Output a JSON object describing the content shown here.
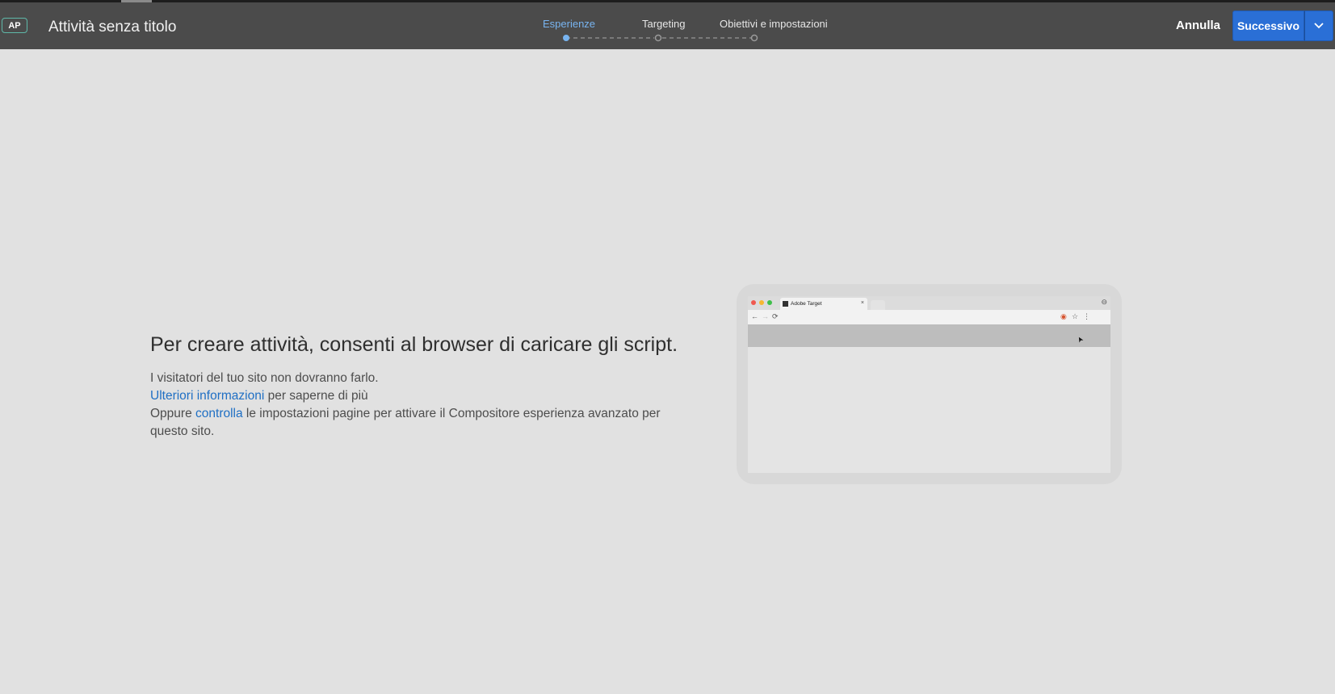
{
  "header": {
    "badge": "AP",
    "title": "Attività senza titolo",
    "steps": [
      {
        "label": "Esperienze",
        "active": true
      },
      {
        "label": "Targeting",
        "active": false
      },
      {
        "label": "Obiettivi e impostazioni",
        "active": false
      }
    ],
    "cancel_label": "Annulla",
    "next_label": "Successivo"
  },
  "main": {
    "heading": "Per creare attività, consenti al browser di caricare gli script.",
    "line1": "I visitatori del tuo sito non dovranno farlo.",
    "line2_link": "Ulteriori informazioni",
    "line2_rest": " per saperne di più",
    "line3_prefix": "Oppure ",
    "line3_link": "controlla",
    "line3_rest": " le impostazioni pagine per attivare il Compositore esperienza avanzato per questo sito."
  },
  "illustration": {
    "tab_title": "Adobe Target",
    "tab_close": "×",
    "user_icon": "⊖",
    "back_icon": "←",
    "forward_icon": "→",
    "reload_icon": "⟳",
    "extension_icon": "◉",
    "star_icon": "☆",
    "menu_icon": "⋮",
    "cursor_icon": "➤"
  },
  "colors": {
    "header_bg": "#4b4b4b",
    "page_bg": "#e1e1e1",
    "accent_blue": "#2a6fd6",
    "link_blue": "#1f6fc4",
    "active_step": "#78b4f0",
    "badge_border": "#5fb8a9"
  }
}
